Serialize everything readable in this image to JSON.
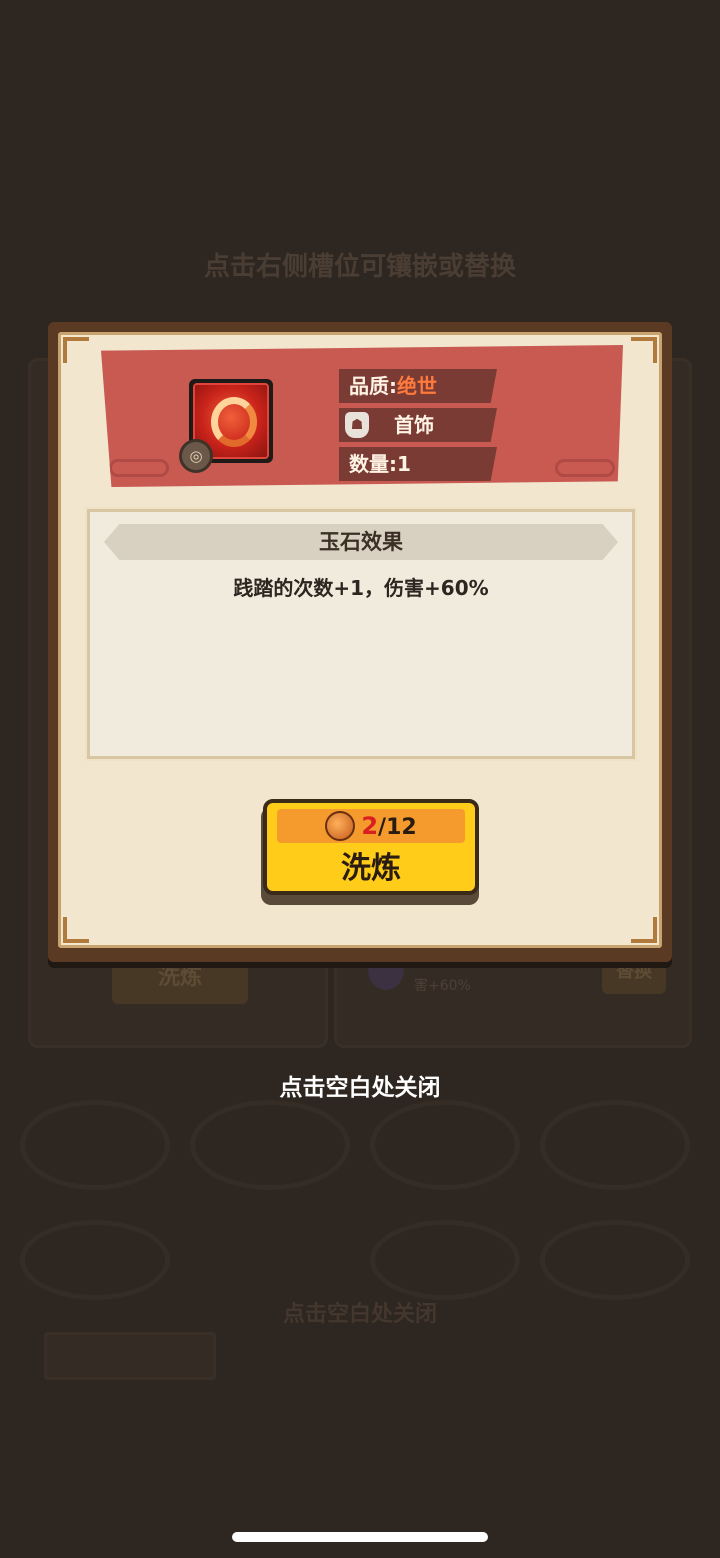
{
  "background": {
    "slot_hint": "点击右侧槽位可镶嵌或替换",
    "left_button": "洗炼",
    "right_button": "替换",
    "row_text": "害+60%",
    "close_hint": "点击空白处关闭"
  },
  "item": {
    "quality_label": "品质:",
    "quality_value": "绝世",
    "type_label": "首饰",
    "quantity_label": "数量:",
    "quantity_value": "1"
  },
  "effect": {
    "title": "玉石效果",
    "description": "践踏的次数+1，伤害+60%"
  },
  "refine": {
    "current": "2",
    "separator": "/",
    "max": "12",
    "label": "洗炼"
  },
  "close_hint": "点击空白处关闭",
  "colors": {
    "quality": "#ff7a3c",
    "banner": "#c85a52",
    "button": "#ffcc1a"
  }
}
